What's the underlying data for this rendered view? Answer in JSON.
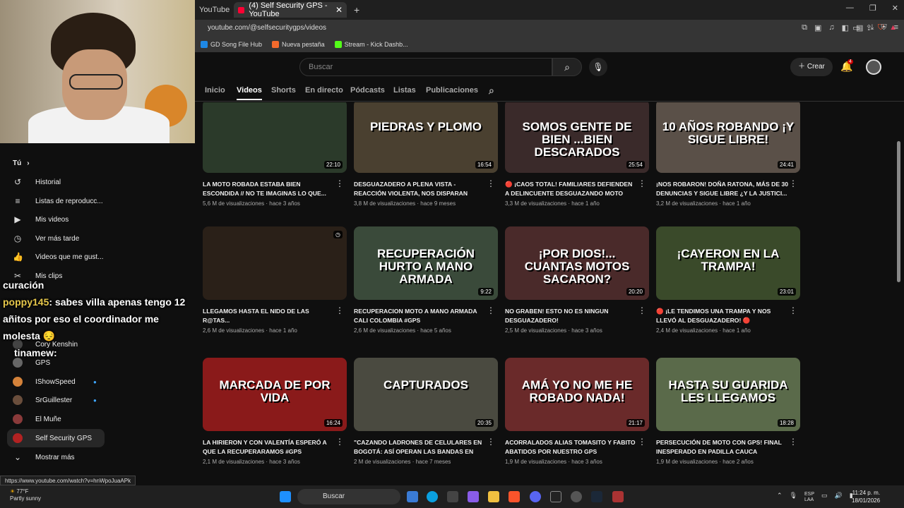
{
  "browser": {
    "prev_tab_label": "YouTube",
    "active_tab_label": "(4) Self Security GPS - YouTube",
    "close_tab": "✕",
    "new_tab": "+",
    "url": "youtube.com/@selfsecuritygps/videos",
    "bookmarks": [
      {
        "label": "GD Song File Hub",
        "color": "#1e88e5"
      },
      {
        "label": "Nueva pestaña",
        "color": "#f36a2c"
      },
      {
        "label": "Stream - Kick Dashb...",
        "color": "#53fc18"
      }
    ]
  },
  "chat": {
    "line1": "curación",
    "user1": "poppy145",
    "msg1": ": sabes villa apenas tengo 12 añitos por eso el coordinador me molesta 😔",
    "user2": "tinamew",
    "msg2": ":"
  },
  "sidebar": {
    "you_label": "Tú",
    "items": [
      {
        "label": "Historial",
        "icon": "history-icon"
      },
      {
        "label": "Listas de reproducc...",
        "icon": "playlist-icon"
      },
      {
        "label": "Mis videos",
        "icon": "my-videos-icon"
      },
      {
        "label": "Ver más tarde",
        "icon": "watch-later-icon"
      },
      {
        "label": "Videos que me gust...",
        "icon": "like-icon"
      },
      {
        "label": "Mis clips",
        "icon": "scissors-icon"
      }
    ],
    "subs": [
      {
        "label": "Cory Kenshin",
        "color": "#444"
      },
      {
        "label": "GPS",
        "color": "#666"
      },
      {
        "label": "IShowSpeed",
        "color": "#d4823a"
      },
      {
        "label": "SrGuillester",
        "color": "#6a4e3c"
      },
      {
        "label": "El Muñe",
        "color": "#8a3a3a"
      },
      {
        "label": "Self Security GPS",
        "color": "#b22222"
      }
    ],
    "show_more": "Mostrar más"
  },
  "status_url": "https://www.youtube.com/watch?v=hnWpoJuaAPk",
  "youtube": {
    "search_placeholder": "Buscar",
    "create_label": "Crear",
    "notif_count": "4",
    "tabs": [
      "Inicio",
      "Videos",
      "Shorts",
      "En directo",
      "Pódcasts",
      "Listas",
      "Publicaciones"
    ]
  },
  "videos": [
    {
      "thumb_text": "",
      "bg": "#2b3a2a",
      "duration": "22:10",
      "title": "LA MOTO ROBADA ESTABA BIEN ESCONDIDA // NO TE IMAGINAS LO QUE...",
      "meta": "5,6 M de visualizaciones · hace 3 años"
    },
    {
      "thumb_text": "PIEDRAS Y PLOMO",
      "bg": "#4a4030",
      "duration": "16:54",
      "title": "DESGUAZADERO A PLENA VISTA - REACCIÓN VIOLENTA, NOS DISPARAN PER...",
      "meta": "3,8 M de visualizaciones · hace 9 meses"
    },
    {
      "thumb_text": "SOMOS GENTE DE BIEN ...BIEN DESCARADOS",
      "bg": "#3a2a2a",
      "duration": "25:54",
      "title": "🔴 ¡CAOS TOTAL! Familiares Defienden a Delincuente Desguazando Moto Robada |...",
      "meta": "3,3 M de visualizaciones · hace 1 año"
    },
    {
      "thumb_text": "10 AÑOS ROBANDO ¡Y SIGUE LIBRE!",
      "bg": "#5a5048",
      "duration": "24:41",
      "title": "¡NOS ROBARON! DOÑA RATONA, más de 30 DENUNCIAS Y SIGUE LIBRE ¿Y LA JUSTICI...",
      "meta": "3,2 M de visualizaciones · hace 1 año"
    },
    {
      "thumb_text": "",
      "bg": "#2a2018",
      "duration": "",
      "title": "LLEGAMOS HASTA EL NIDO DE LAS R@TAS...",
      "meta": "2,6 M de visualizaciones · hace 1 año"
    },
    {
      "thumb_text": "RECUPERACIÓN HURTO A MANO ARMADA",
      "bg": "#3a4a3a",
      "duration": "9:22",
      "title": "RECUPERACION MOTO A MANO ARMADA CALI COLOMBIA #gps",
      "meta": "2,6 M de visualizaciones · hace 5 años"
    },
    {
      "thumb_text": "¡POR DIOS!... CUANTAS MOTOS SACARON?",
      "bg": "#4a2a2a",
      "duration": "20:20",
      "title": "NO GRABEN! ESTO NO ES NINGUN DESGUAZADERO!",
      "meta": "2,5 M de visualizaciones · hace 3 años"
    },
    {
      "thumb_text": "¡CAYERON EN LA TRAMPA!",
      "bg": "#3a4a2a",
      "duration": "23:01",
      "title": "🔴 ¡LE TENDIMOS UNA TRAMPA Y NOS LLEVÓ AL DESGUAZADERO! 🔴",
      "meta": "2,4 M de visualizaciones · hace 1 año"
    },
    {
      "thumb_text": "MARCADA DE POR VIDA",
      "bg": "#8a1a1a",
      "duration": "16:24",
      "title": "LA HIRIERON Y CON VALENTÍA ESPERÓ A QUE LA RECUPERARAMOS #gps",
      "meta": "2,1 M de visualizaciones · hace 3 años"
    },
    {
      "thumb_text": "CAPTURADOS",
      "bg": "#4a4a40",
      "duration": "20:35",
      "title": "\"CAZANDO LADRONES DE CELULARES EN BOGOTÁ: así operan las bandas en motos\"",
      "meta": "2 M de visualizaciones · hace 7 meses"
    },
    {
      "thumb_text": "AMÁ YO NO ME HE ROBADO NADA!",
      "bg": "#6a2a2a",
      "duration": "21:17",
      "title": "ACORRALADOS ALIAS TOMASITO Y FABITO ABATIDOS POR NUESTRO GPS",
      "meta": "1,9 M de visualizaciones · hace 3 años"
    },
    {
      "thumb_text": "HASTA SU GUARIDA LES LLEGAMOS",
      "bg": "#5a6a4a",
      "duration": "18:28",
      "title": "PERSECUCIÓN DE MOTO CON GPS! FINAL INESPERADO EN PADILLA CAUCA",
      "meta": "1,9 M de visualizaciones · hace 2 años"
    }
  ],
  "taskbar": {
    "temp": "77°F",
    "weather": "Partly sunny",
    "search": "Buscar",
    "lang1": "ESP",
    "lang2": "LAA",
    "time": "11:24 p. m.",
    "date": "18/01/2026"
  }
}
